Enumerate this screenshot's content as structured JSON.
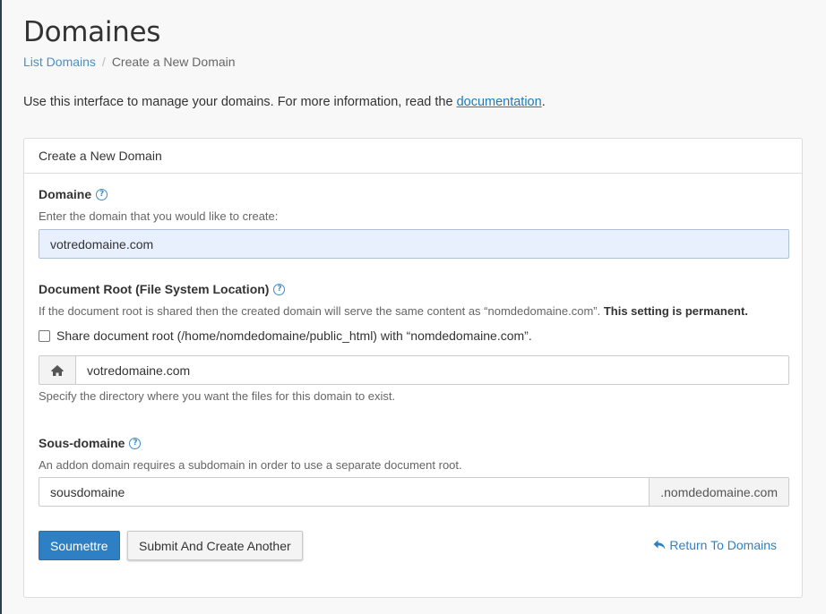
{
  "page": {
    "title": "Domaines",
    "breadcrumb": {
      "link": "List Domains",
      "separator": "/",
      "current": "Create a New Domain"
    },
    "intro": {
      "text": "Use this interface to manage your domains. For more information, read the ",
      "link": "documentation",
      "end": "."
    }
  },
  "panel": {
    "heading": "Create a New Domain",
    "domain": {
      "label": "Domaine",
      "help_icon": "?",
      "hint": "Enter the domain that you would like to create:",
      "value": "votredomaine.com"
    },
    "docroot": {
      "label": "Document Root (File System Location)",
      "help_icon": "?",
      "hint": "If the document root is shared then the created domain will serve the same content as “nomdedomaine.com”. ",
      "hint_bold": "This setting is permanent.",
      "checkbox_label": "Share document root (/home/nomdedomaine/public_html) with “nomdedomaine.com”.",
      "checkbox_checked": false,
      "icon": "home-icon",
      "value": "votredomaine.com",
      "after_hint": "Specify the directory where you want the files for this domain to exist."
    },
    "subdomain": {
      "label": "Sous-domaine",
      "help_icon": "?",
      "hint": "An addon domain requires a subdomain in order to use a separate document root.",
      "value": "sousdomaine",
      "suffix": ".nomdedomaine.com"
    },
    "actions": {
      "submit": "Soumettre",
      "submit_another": "Submit And Create Another",
      "return": "Return To Domains",
      "return_icon": "reply-icon"
    }
  },
  "colors": {
    "primary": "#2f7fc4",
    "link": "#1f7bb5",
    "focused_input": "#e8f0fe"
  }
}
